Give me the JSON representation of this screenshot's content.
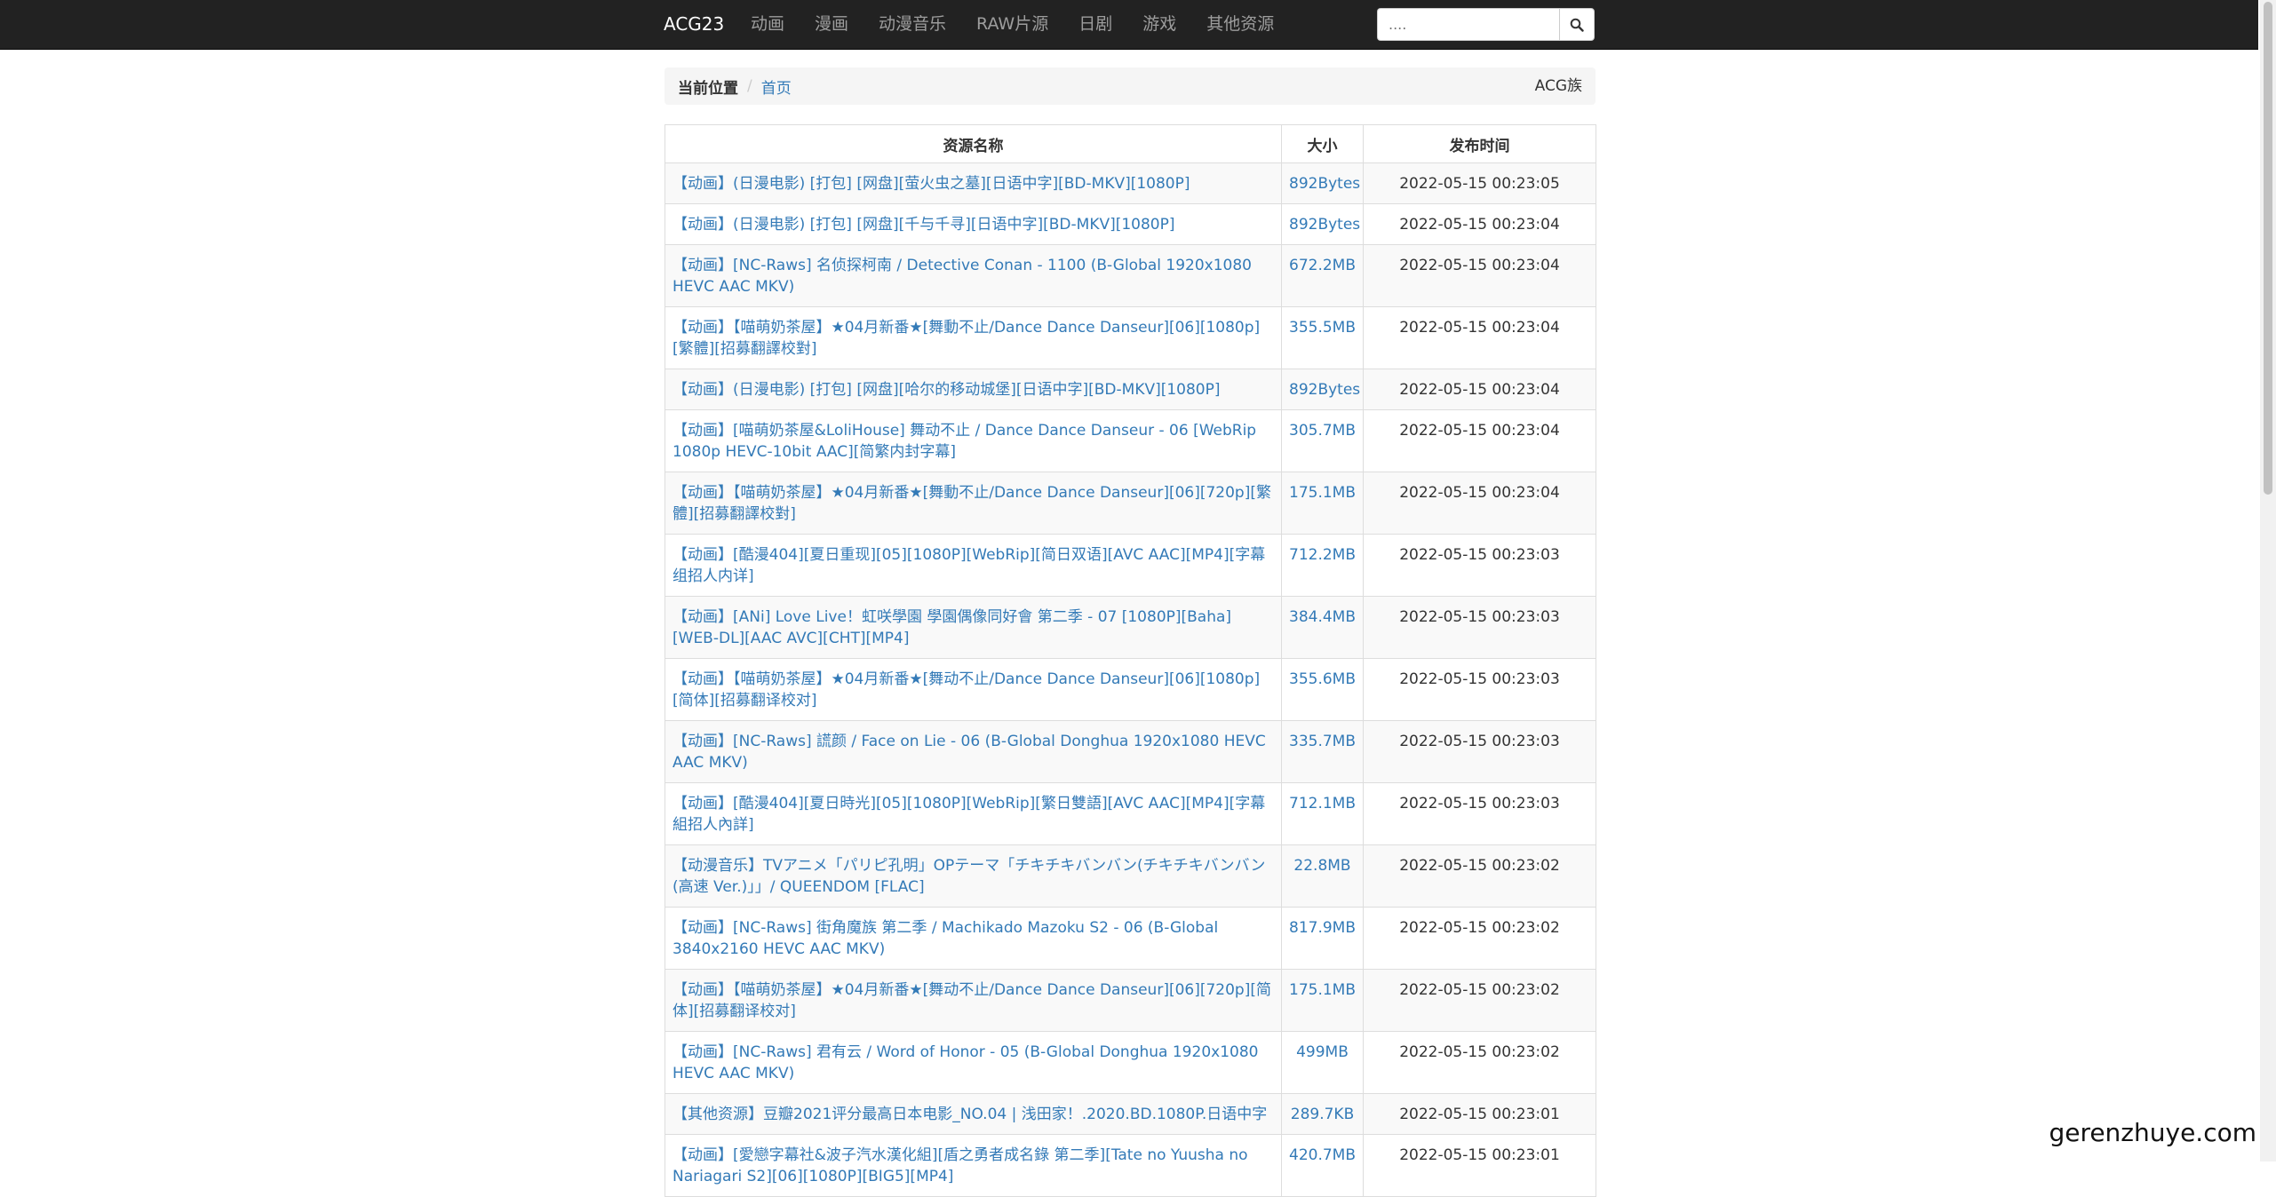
{
  "nav": {
    "brand": "ACG23",
    "items": [
      "动画",
      "漫画",
      "动漫音乐",
      "RAW片源",
      "日剧",
      "游戏",
      "其他资源"
    ],
    "search_placeholder": "....",
    "search_icon": "search-icon"
  },
  "breadcrumb": {
    "current_label": "当前位置",
    "home": "首页",
    "right": "ACG族"
  },
  "table": {
    "headers": [
      "资源名称",
      "大小",
      "发布时间"
    ],
    "rows": [
      {
        "name": "【动画】(日漫电影) [打包] [网盘][萤火虫之墓][日语中字][BD-MKV][1080P]",
        "size": "892Bytes",
        "time": "2022-05-15 00:23:05"
      },
      {
        "name": "【动画】(日漫电影) [打包] [网盘][千与千寻][日语中字][BD-MKV][1080P]",
        "size": "892Bytes",
        "time": "2022-05-15 00:23:04"
      },
      {
        "name": "【动画】[NC-Raws] 名侦探柯南 / Detective Conan - 1100 (B-Global 1920x1080 HEVC AAC MKV)",
        "size": "672.2MB",
        "time": "2022-05-15 00:23:04"
      },
      {
        "name": "【动画】【喵萌奶茶屋】★04月新番★[舞動不止/Dance Dance Danseur][06][1080p][繁體][招募翻譯校對]",
        "size": "355.5MB",
        "time": "2022-05-15 00:23:04"
      },
      {
        "name": "【动画】(日漫电影) [打包] [网盘][哈尔的移动城堡][日语中字][BD-MKV][1080P]",
        "size": "892Bytes",
        "time": "2022-05-15 00:23:04"
      },
      {
        "name": "【动画】[喵萌奶茶屋&LoliHouse] 舞动不止 / Dance Dance Danseur - 06 [WebRip 1080p HEVC-10bit AAC][简繁内封字幕]",
        "size": "305.7MB",
        "time": "2022-05-15 00:23:04"
      },
      {
        "name": "【动画】【喵萌奶茶屋】★04月新番★[舞動不止/Dance Dance Danseur][06][720p][繁體][招募翻譯校對]",
        "size": "175.1MB",
        "time": "2022-05-15 00:23:04"
      },
      {
        "name": "【动画】[酷漫404][夏日重现][05][1080P][WebRip][简日双语][AVC AAC][MP4][字幕组招人内详]",
        "size": "712.2MB",
        "time": "2022-05-15 00:23:03"
      },
      {
        "name": "【动画】[ANi] Love Live！虹咲學園 學園偶像同好會 第二季 - 07 [1080P][Baha][WEB-DL][AAC AVC][CHT][MP4]",
        "size": "384.4MB",
        "time": "2022-05-15 00:23:03"
      },
      {
        "name": "【动画】【喵萌奶茶屋】★04月新番★[舞动不止/Dance Dance Danseur][06][1080p][简体][招募翻译校对]",
        "size": "355.6MB",
        "time": "2022-05-15 00:23:03"
      },
      {
        "name": "【动画】[NC-Raws] 謊颜 / Face on Lie - 06 (B-Global Donghua 1920x1080 HEVC AAC MKV)",
        "size": "335.7MB",
        "time": "2022-05-15 00:23:03"
      },
      {
        "name": "【动画】[酷漫404][夏日時光][05][1080P][WebRip][繁日雙語][AVC AAC][MP4][字幕組招人內詳]",
        "size": "712.1MB",
        "time": "2022-05-15 00:23:03"
      },
      {
        "name": "【动漫音乐】TVアニメ「パリピ孔明」OPテーマ「チキチキバンバン(チキチキバンバン(高速 Ver.)」」/ QUEENDOM [FLAC]",
        "size": "22.8MB",
        "time": "2022-05-15 00:23:02"
      },
      {
        "name": "【动画】[NC-Raws] 街角魔族 第二季 / Machikado Mazoku S2 - 06 (B-Global 3840x2160 HEVC AAC MKV)",
        "size": "817.9MB",
        "time": "2022-05-15 00:23:02"
      },
      {
        "name": "【动画】【喵萌奶茶屋】★04月新番★[舞动不止/Dance Dance Danseur][06][720p][简体][招募翻译校对]",
        "size": "175.1MB",
        "time": "2022-05-15 00:23:02"
      },
      {
        "name": "【动画】[NC-Raws] 君有云 / Word of Honor - 05 (B-Global Donghua 1920x1080 HEVC AAC MKV)",
        "size": "499MB",
        "time": "2022-05-15 00:23:02"
      },
      {
        "name": "【其他资源】豆瓣2021评分最高日本电影_NO.04 | 浅田家！.2020.BD.1080P.日语中字",
        "size": "289.7KB",
        "time": "2022-05-15 00:23:01"
      },
      {
        "name": "【动画】[愛戀字幕社&波子汽水漢化組][盾之勇者成名錄 第二季][Tate no Yuusha no Nariagari S2][06][1080P][BIG5][MP4]",
        "size": "420.7MB",
        "time": "2022-05-15 00:23:01"
      }
    ]
  },
  "watermark": "gerenzhuye.com"
}
